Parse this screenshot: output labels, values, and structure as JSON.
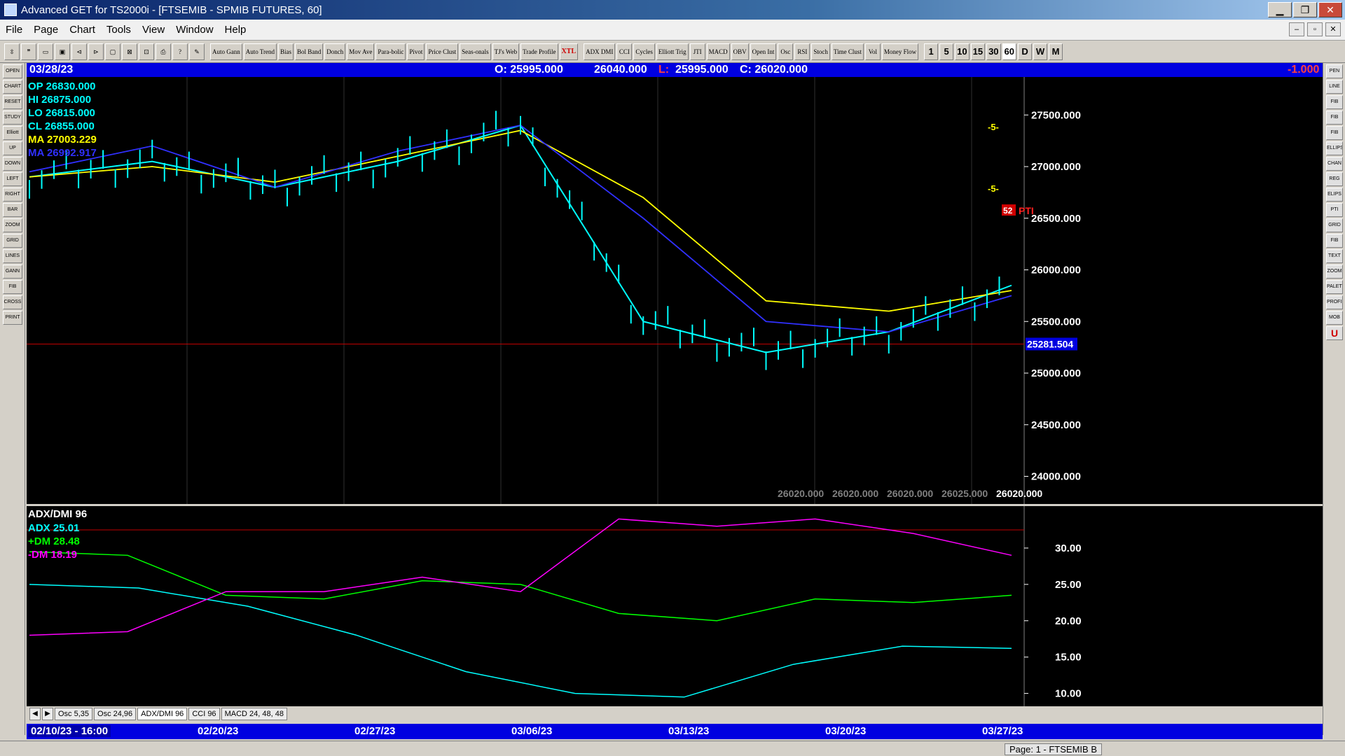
{
  "window": {
    "title": "Advanced GET for TS2000i - [FTSEMIB - SPMIB FUTURES, 60]",
    "minimize": "▁",
    "maximize": "❐",
    "close": "✕"
  },
  "menu": {
    "items": [
      "File",
      "Page",
      "Chart",
      "Tools",
      "View",
      "Window",
      "Help"
    ],
    "mdi_min": "–",
    "mdi_restore": "▫",
    "mdi_close": "✕"
  },
  "toolbar": {
    "studies": [
      "Auto Gann",
      "Auto Trend",
      "Bias",
      "Bol Band",
      "Donch",
      "Mov Ave",
      "Para-bolic",
      "Pivot",
      "Price Clust",
      "Seas-onals",
      "TJ's Web",
      "Trade Profile",
      "XTL",
      "ADX DMI",
      "CCI",
      "Cycles",
      "Elliott Trig",
      "JTI",
      "MACD",
      "OBV",
      "Open Int",
      "Osc",
      "RSI",
      "Stoch",
      "Time Clust",
      "Vol",
      "Money Flow"
    ],
    "periods": [
      "1",
      "5",
      "10",
      "15",
      "30",
      "60",
      "D",
      "W",
      "M"
    ]
  },
  "left_tools": [
    "OPEN",
    "CHART",
    "RESET",
    "STUDY",
    "Elliott",
    "UP",
    "DOWN",
    "LEFT",
    "RIGHT",
    "BAR",
    "ZOOM",
    "GRID",
    "LINES",
    "GANN",
    "FIB",
    "CROSS",
    "PRINT"
  ],
  "right_tools": [
    "PEN",
    "LINE",
    "FIB RET",
    "FIB EXT",
    "FIB TIME",
    "ELLIPSE",
    "CHAN",
    "REG",
    "ELIPS",
    "PTI",
    "GRID",
    "FIB",
    "TEXT",
    "ZOOM",
    "PALETTE",
    "PROFILE",
    "MOB",
    "U"
  ],
  "infobar": {
    "date": "03/28/23",
    "open": "O: 25995.000",
    "high": "26040.000",
    "low_label": "L:",
    "low": "25995.000",
    "close": "C: 26020.000",
    "change": "-1.000"
  },
  "price_panel": {
    "legend": [
      {
        "label": "OP",
        "value": "26830.000",
        "color": "#00ffff"
      },
      {
        "label": "HI",
        "value": "26875.000",
        "color": "#00ffff"
      },
      {
        "label": "LO",
        "value": "26815.000",
        "color": "#00ffff"
      },
      {
        "label": "CL",
        "value": "26855.000",
        "color": "#00ffff"
      },
      {
        "label": "MA",
        "value": "27003.229",
        "color": "#ffff00"
      },
      {
        "label": "MA",
        "value": "26992.917",
        "color": "#3030ff"
      }
    ],
    "current_price": "25281.504",
    "y_ticks": [
      "27500.000",
      "27000.000",
      "26500.000",
      "26000.000",
      "25500.000",
      "25000.000",
      "24500.000",
      "24000.000"
    ],
    "bottom_values": [
      "26020.000",
      "26020.000",
      "26020.000",
      "26025.000",
      "26020.000"
    ],
    "pti": {
      "value": "52",
      "label": "PTI"
    },
    "projection_labels": [
      "-5-",
      "-5-"
    ]
  },
  "indicator_panel": {
    "title": "ADX/DMI 96",
    "legend": [
      {
        "label": "ADX",
        "value": "25.01",
        "color": "#00ffff"
      },
      {
        "label": "+DM",
        "value": "28.48",
        "color": "#00ff00"
      },
      {
        "label": "-DM",
        "value": "18.19",
        "color": "#ff00ff"
      }
    ],
    "y_ticks": [
      "30.00",
      "25.00",
      "20.00",
      "15.00",
      "10.00"
    ]
  },
  "tabs": [
    "Osc 5,35",
    "Osc 24,96",
    "ADX/DMI 96",
    "CCI 96",
    "MACD 24, 48, 48"
  ],
  "active_tab": "ADX/DMI 96",
  "tab_nav": {
    "prev": "◀",
    "next": "▶"
  },
  "date_axis": [
    "02/10/23 - 16:00",
    "02/20/23",
    "02/27/23",
    "03/06/23",
    "03/13/23",
    "03/20/23",
    "03/27/23"
  ],
  "status": {
    "page": "Page: 1 - FTSEMIB B"
  },
  "chart_data": {
    "type": "line",
    "title": "FTSEMIB - SPMIB FUTURES, 60",
    "x": [
      "02/10/23",
      "02/20/23",
      "02/27/23",
      "03/06/23",
      "03/13/23",
      "03/20/23",
      "03/27/23"
    ],
    "ylim": [
      23800,
      27800
    ],
    "series": [
      {
        "name": "Price",
        "color": "#00ffff",
        "values": [
          26900,
          27050,
          26800,
          27050,
          27400,
          25500,
          25200,
          25400,
          25850
        ]
      },
      {
        "name": "MA",
        "color": "#ffff00",
        "values": [
          26900,
          27000,
          26850,
          27100,
          27350,
          26700,
          25700,
          25600,
          25800
        ]
      },
      {
        "name": "MA",
        "color": "#3030ff",
        "values": [
          26950,
          27200,
          26800,
          27150,
          27400,
          26500,
          25500,
          25400,
          25750
        ]
      }
    ],
    "indicator": {
      "type": "line",
      "title": "ADX/DMI 96",
      "ylim": [
        9,
        35
      ],
      "series": [
        {
          "name": "ADX",
          "color": "#00ffff",
          "values": [
            25,
            24.5,
            22,
            18,
            13,
            10,
            9.5,
            14,
            16.5,
            16.2
          ]
        },
        {
          "name": "+DM",
          "color": "#00ff00",
          "values": [
            29.5,
            29,
            23.5,
            23,
            25.5,
            25,
            21,
            20,
            23,
            22.5,
            23.5
          ]
        },
        {
          "name": "-DM",
          "color": "#ff00ff",
          "values": [
            18,
            18.5,
            24,
            24,
            26,
            24,
            34,
            33,
            34,
            32,
            29
          ]
        }
      ]
    }
  }
}
